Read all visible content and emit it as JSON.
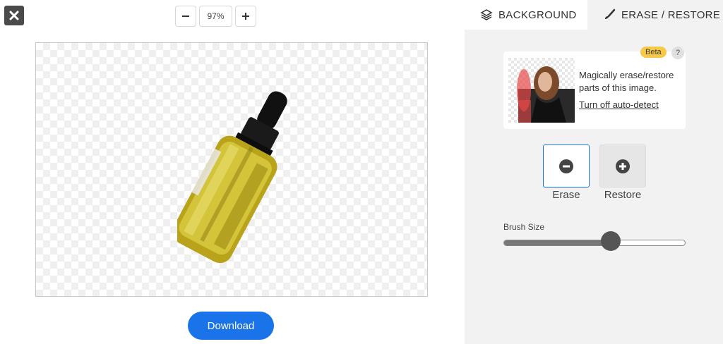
{
  "toolbar": {
    "close_icon": "close-icon",
    "zoom_out_symbol": "−",
    "zoom_value": "97%",
    "zoom_in_symbol": "+"
  },
  "tabs": [
    {
      "label": "BACKGROUND",
      "icon": "layers-icon"
    },
    {
      "label": "ERASE / RESTORE",
      "icon": "brush-icon"
    }
  ],
  "card": {
    "badge": "Beta",
    "help": "?",
    "description": "Magically erase/restore parts of this image.",
    "link": "Turn off auto-detect"
  },
  "modes": {
    "erase_label": "Erase",
    "restore_label": "Restore",
    "selected": "Erase"
  },
  "brush": {
    "label": "Brush Size",
    "value_fraction": 0.59
  },
  "download_label": "Download",
  "colors": {
    "accent": "#1a73e8",
    "beta_badge": "#f7c948",
    "panel_bg": "#f2f2f2"
  }
}
